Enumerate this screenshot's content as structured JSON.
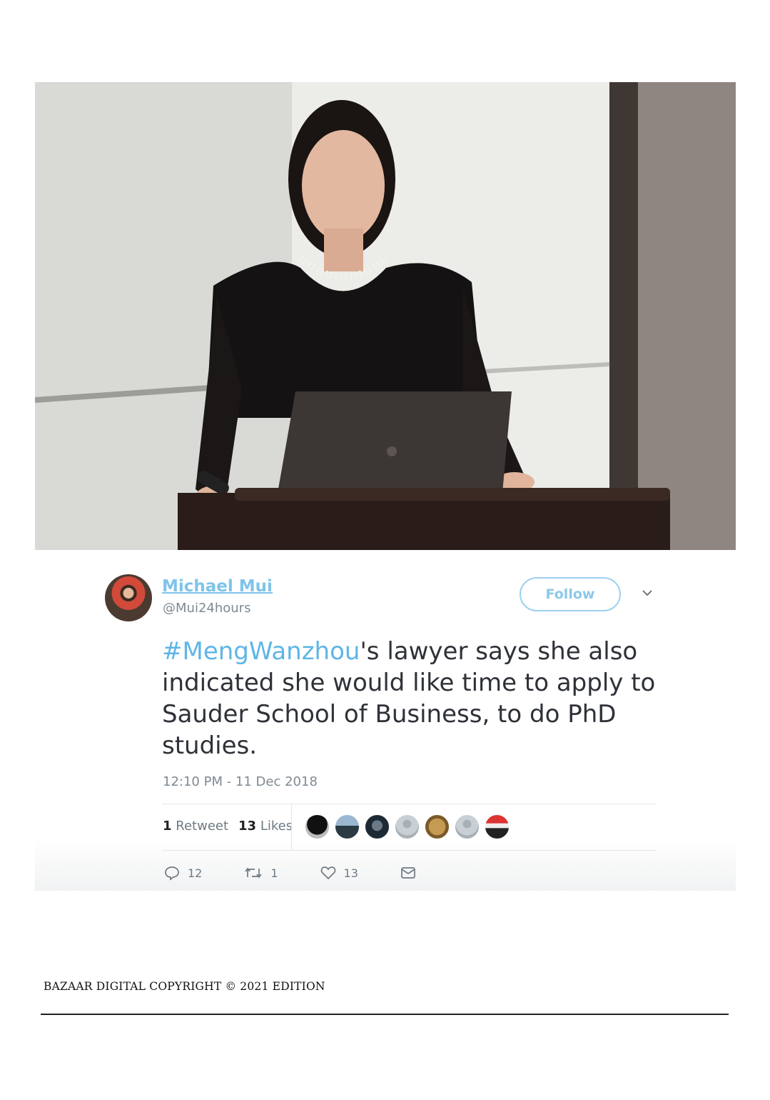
{
  "tweet": {
    "author_name": "Michael Mui",
    "author_handle": "@Mui24hours",
    "follow_label": "Follow",
    "text_hashtag": "#MengWanzhou",
    "text_body": "'s lawyer says she also indicated she would like time to apply to Sauder School of Business, to do PhD studies.",
    "timestamp": "12:10 PM - 11 Dec 2018",
    "retweet_count": "1",
    "retweet_label": "Retweet",
    "like_count": "13",
    "like_label": "Likes",
    "actions": {
      "reply_count": "12",
      "retweet_count": "1",
      "like_count": "13"
    },
    "colors": {
      "link": "#5fb5e6",
      "follow_border": "#9ed1ee"
    }
  },
  "footer": {
    "copyright": "BAZAAR DIGITAL COPYRIGHT © 2021 EDITION"
  }
}
